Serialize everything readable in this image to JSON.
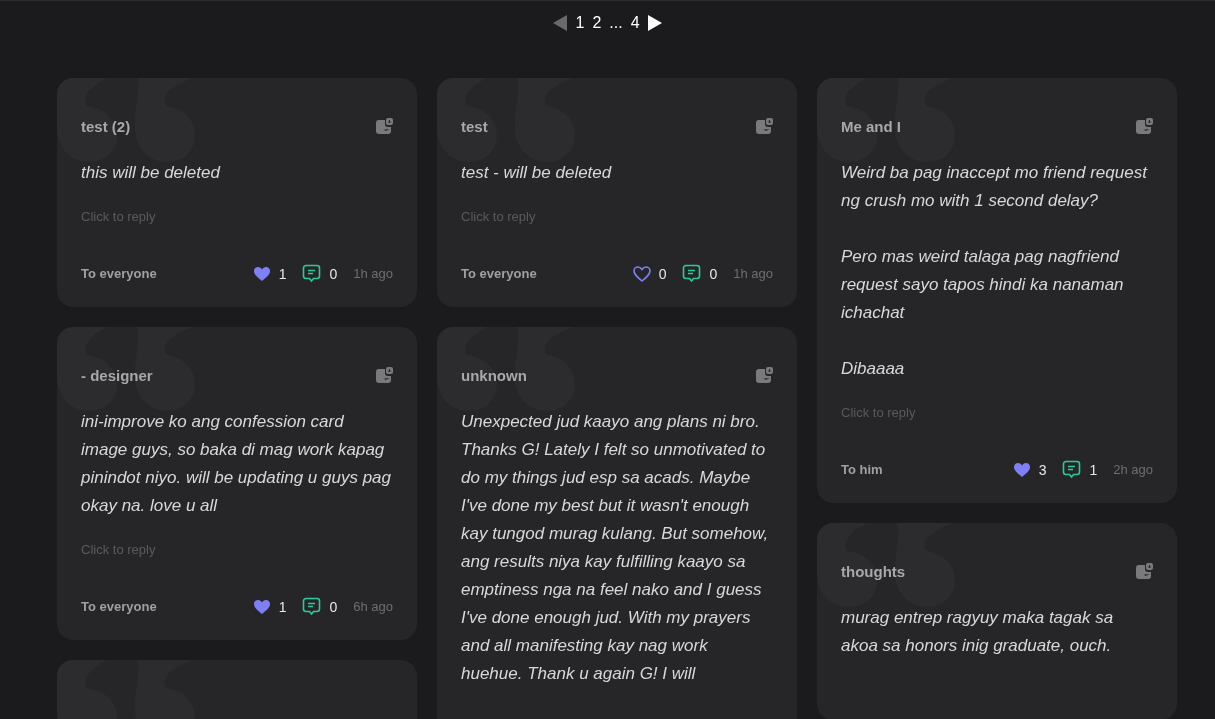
{
  "pagination": {
    "prev_disabled": true,
    "next_disabled": false,
    "pages": [
      "1",
      "2",
      "...",
      "4"
    ]
  },
  "columns": [
    [
      {
        "kind": "full",
        "title": "test (2)",
        "body": "this will be deleted",
        "reply_hint": "Click to reply",
        "recipient": "To everyone",
        "liked": true,
        "likes": "1",
        "comments": "0",
        "time": "1h ago"
      },
      {
        "kind": "full",
        "title": "- designer",
        "body": "ini-improve ko ang confession card image guys, so baka di mag work kapag pinindot niyo. will be updating u guys pag okay na. love u all",
        "reply_hint": "Click to reply",
        "recipient": "To everyone",
        "liked": true,
        "likes": "1",
        "comments": "0",
        "time": "6h ago"
      },
      {
        "kind": "cut"
      }
    ],
    [
      {
        "kind": "full",
        "title": "test",
        "body": "test - will be deleted",
        "reply_hint": "Click to reply",
        "recipient": "To everyone",
        "liked": false,
        "likes": "0",
        "comments": "0",
        "time": "1h ago"
      },
      {
        "kind": "full",
        "title": "unknown",
        "body": "Unexpected jud kaayo ang plans ni bro. Thanks G! Lately I felt so unmotivated to do my things jud esp sa acads. Maybe I've done my best but it wasn't enough kay tungod murag kulang. But somehow, ang results niya kay fulfilling kaayo sa emptiness nga na feel nako and I guess I've done enough jud. With my prayers and all manifesting kay nag work huehue. Thank u again G! I will"
      }
    ],
    [
      {
        "kind": "full",
        "title": "Me and I",
        "body": "Weird ba pag inaccept mo friend request ng crush mo with 1 second delay?\n\nPero mas weird talaga pag nagfriend request sayo tapos hindi ka nanaman ichachat\n\nDibaaaa",
        "reply_hint": "Click to reply",
        "recipient": "To him",
        "liked": true,
        "likes": "3",
        "comments": "1",
        "time": "2h ago"
      },
      {
        "kind": "full",
        "title": "thoughts",
        "body": "murag entrep ragyuy maka tagak sa akoa sa honors inig graduate, ouch."
      }
    ]
  ]
}
